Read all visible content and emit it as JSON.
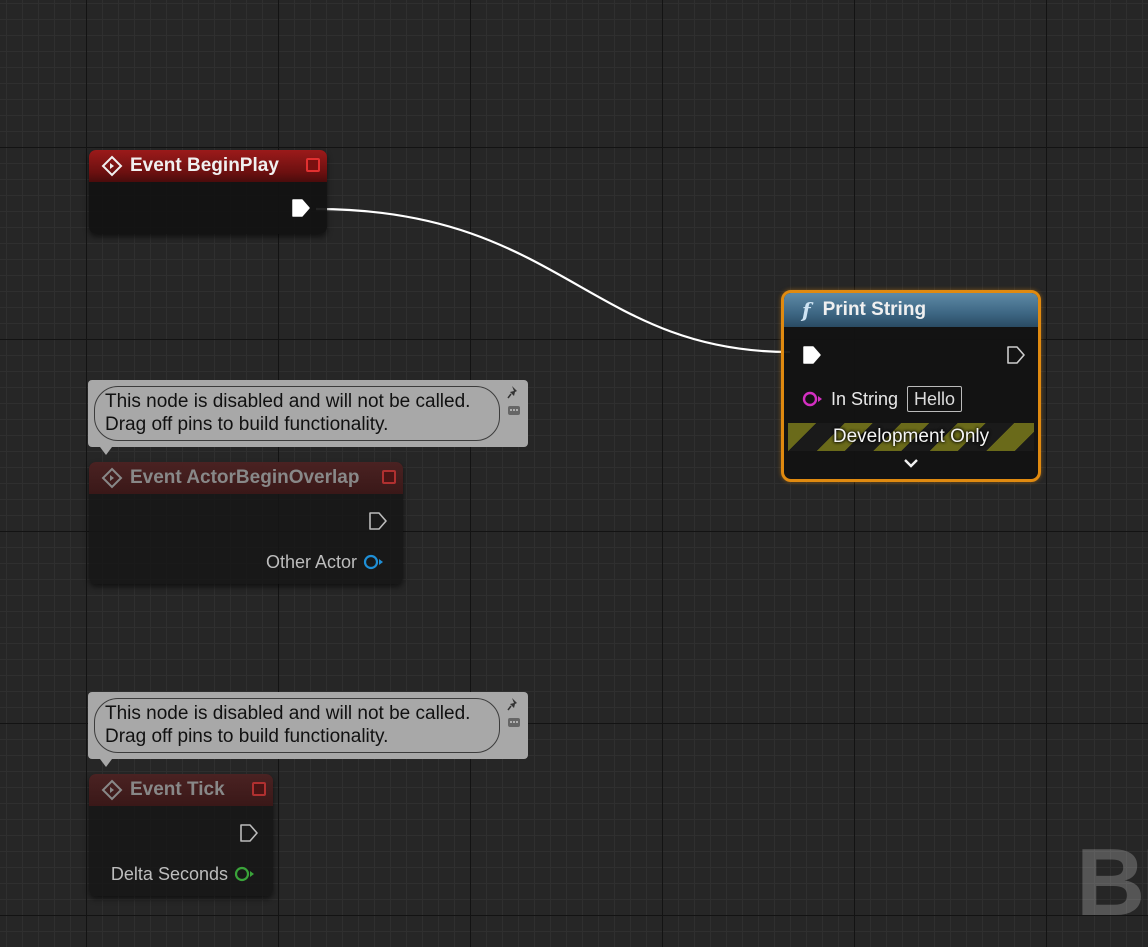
{
  "nodes": {
    "begin_play": {
      "title": "Event BeginPlay"
    },
    "actor_overlap": {
      "title": "Event ActorBeginOverlap",
      "output_pin_label": "Other Actor"
    },
    "tick": {
      "title": "Event Tick",
      "output_pin_label": "Delta Seconds"
    },
    "print_string": {
      "title": "Print String",
      "func_symbol": "f",
      "input_label": "In String",
      "input_value": "Hello",
      "dev_label": "Development Only"
    }
  },
  "comments": {
    "overlap": {
      "line1": "This node is disabled and will not be called.",
      "line2": "Drag off pins to build functionality."
    },
    "tick": {
      "line1": "This node is disabled and will not be called.",
      "line2": "Drag off pins to build functionality."
    }
  },
  "watermark": "BL",
  "colors": {
    "event_header": "#9b1a1a",
    "function_header": "#3d6683",
    "selection_outline": "#e08a10",
    "exec_wire": "#ffffff",
    "object_pin": "#1f8fd6",
    "float_pin": "#3aa33a",
    "string_pin": "#d42fc2"
  }
}
